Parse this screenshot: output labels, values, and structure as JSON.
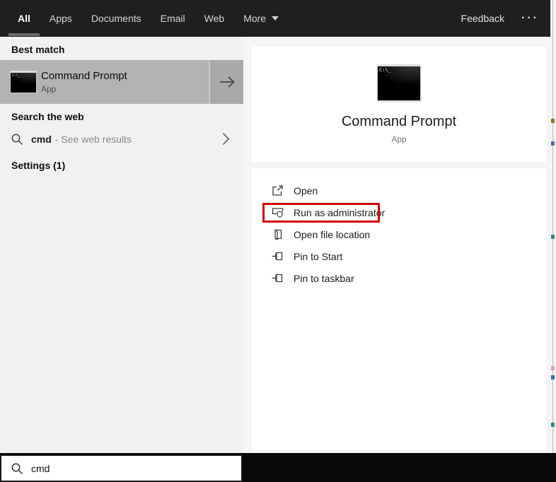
{
  "topbar": {
    "tabs": [
      {
        "label": "All",
        "active": true
      },
      {
        "label": "Apps",
        "active": false
      },
      {
        "label": "Documents",
        "active": false
      },
      {
        "label": "Email",
        "active": false
      },
      {
        "label": "Web",
        "active": false
      },
      {
        "label": "More",
        "active": false
      }
    ],
    "feedback_label": "Feedback",
    "overflow_dots": "···"
  },
  "left": {
    "best_match_header": "Best match",
    "best_match": {
      "title": "Command Prompt",
      "subtitle": "App"
    },
    "web_header": "Search the web",
    "web_item": {
      "query": "cmd",
      "suffix": "- See web results"
    },
    "settings_header": "Settings (1)"
  },
  "preview": {
    "title": "Command Prompt",
    "subtitle": "App",
    "cmd_icon_text": "C:\\_",
    "actions": [
      {
        "label": "Open",
        "highlighted": false
      },
      {
        "label": "Run as administrator",
        "highlighted": true
      },
      {
        "label": "Open file location",
        "highlighted": false
      },
      {
        "label": "Pin to Start",
        "highlighted": false
      },
      {
        "label": "Pin to taskbar",
        "highlighted": false
      }
    ]
  },
  "taskbar": {
    "search_value": "cmd"
  },
  "icons": {
    "open": "launch-window-arrow",
    "run_as_admin": "window-shield",
    "open_file_location": "folder-page",
    "pin": "pushpin",
    "search": "magnifier",
    "go": "arrow-right",
    "see_results": "chevron-right",
    "cortana": "circle-ring",
    "task_view": "task-view-frames",
    "more": "caret-down"
  },
  "colors": {
    "highlight_red": "#d10000",
    "topbar_bg": "#1f1f1f",
    "selected_item_bg": "#b3b3b3",
    "panel_bg": "#f1f1f1",
    "taskbar_bg": "#0a0a0a"
  }
}
